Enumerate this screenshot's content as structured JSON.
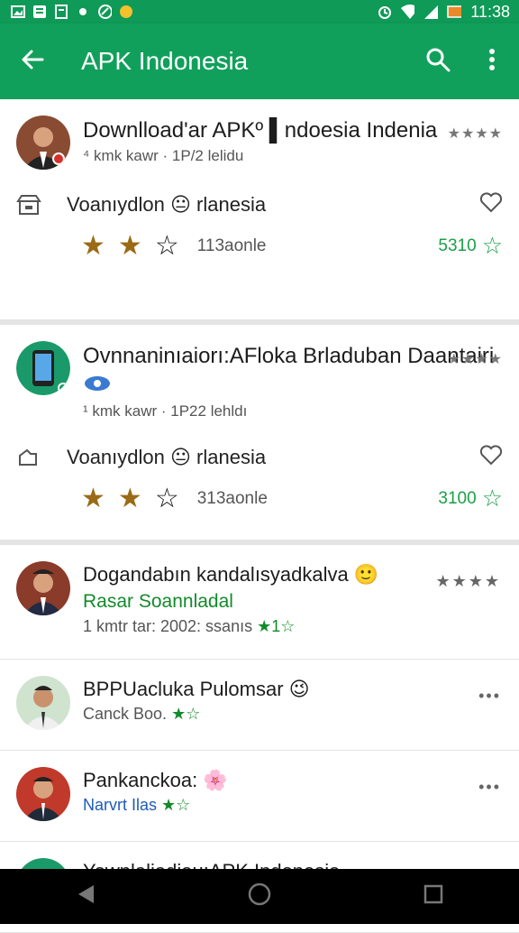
{
  "status_bar": {
    "time": "11:38"
  },
  "app_bar": {
    "title": "APK Indonesia"
  },
  "cards": [
    {
      "title": "Downlload'ar APKº ▌ndoesia Indenia",
      "meta": "⁴ kmk kawr · 1P/2 lelidu",
      "rating_small": "★★★★",
      "sub_label": "Voanıydlon 😐 rlanesia",
      "count": "113aonle",
      "score": "5310"
    },
    {
      "title": "Ovnnaninıaiorı:AFloka Brladuban Daantairi",
      "meta": "¹ kmk kawr · 1P22 lehldı",
      "rating_small": "★★★★",
      "sub_label": "Voanıydlon 😐 rlanesia",
      "count": "313aonle",
      "score": "3100"
    }
  ],
  "items": [
    {
      "title": "Dogandabın kandalısyadkalva 🙂",
      "subtitle": "Rasar Soannladal",
      "meta": "1 kmtr tar: 2002: ssanıs",
      "rating": "★1☆",
      "menu": "★★★★"
    },
    {
      "title": "BPPUacluka Pulomsar 😉",
      "subtitle": "Canck Boo.",
      "rating": "★☆",
      "menu": "•••"
    },
    {
      "title": "Pankanckoa: 🌸",
      "subtitle": "Narvrt Ilas",
      "rating": "★☆",
      "menu": "•••"
    },
    {
      "title": "Yownlaliadiau:APK Indonesia",
      "menu": "•••"
    }
  ]
}
